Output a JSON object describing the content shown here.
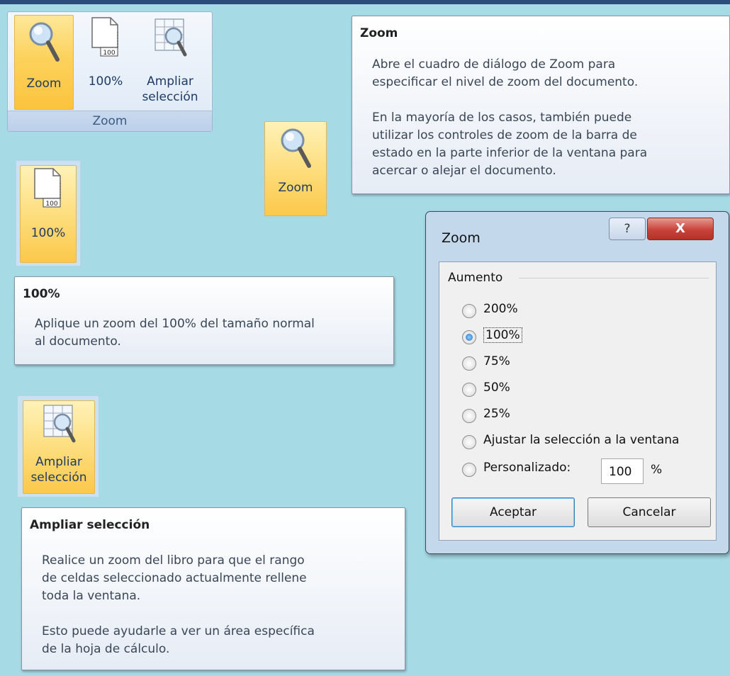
{
  "ribbon": {
    "zoom_label": "Zoom",
    "hundred_label": "100%",
    "zoom_sel_line1": "Ampliar",
    "zoom_sel_line2": "selección",
    "group_label": "Zoom",
    "page_icon_text": "100"
  },
  "buttons": {
    "zoom_label": "Zoom",
    "hundred_label": "100%",
    "zoom_sel_line1": "Ampliar",
    "zoom_sel_line2": "selección",
    "page_icon_text": "100"
  },
  "tooltips": {
    "zoom": {
      "title": "Zoom",
      "body": "Abre el cuadro de diálogo de Zoom para\nespecificar el nivel de zoom del documento.\n\nEn la mayoría de los casos, también puede\nutilizar los controles de zoom de la barra de\nestado en la parte inferior de la ventana para\nacercar o alejar el documento."
    },
    "hundred": {
      "title": "100%",
      "body": "Aplique un zoom del 100% del tamaño normal\nal documento."
    },
    "zoom_selection": {
      "title": "Ampliar selección",
      "body": "Realice un zoom del libro para que el rango\nde celdas seleccionado actualmente rellene\ntoda la ventana.\n\nEsto puede ayudarle a ver un área específica\nde la hoja de cálculo."
    }
  },
  "dialog": {
    "title": "Zoom",
    "help_glyph": "?",
    "close_glyph": "X",
    "group_label": "Aumento",
    "options": [
      "200%",
      "100%",
      "75%",
      "50%",
      "25%",
      "Ajustar la selección a la ventana",
      "Personalizado:"
    ],
    "selected_option": "100%",
    "custom_value": "100",
    "custom_unit": "%",
    "ok_label": "Aceptar",
    "cancel_label": "Cancelar"
  },
  "colors": {
    "background": "#a6dbe5",
    "button_active": "#fcd25c",
    "dialog_frame": "#c4d8ec",
    "close_button": "#c8433b"
  },
  "icons": [
    "magnifier-icon",
    "page-100-icon",
    "grid-magnifier-icon",
    "radio-icon",
    "help-icon",
    "close-icon"
  ]
}
